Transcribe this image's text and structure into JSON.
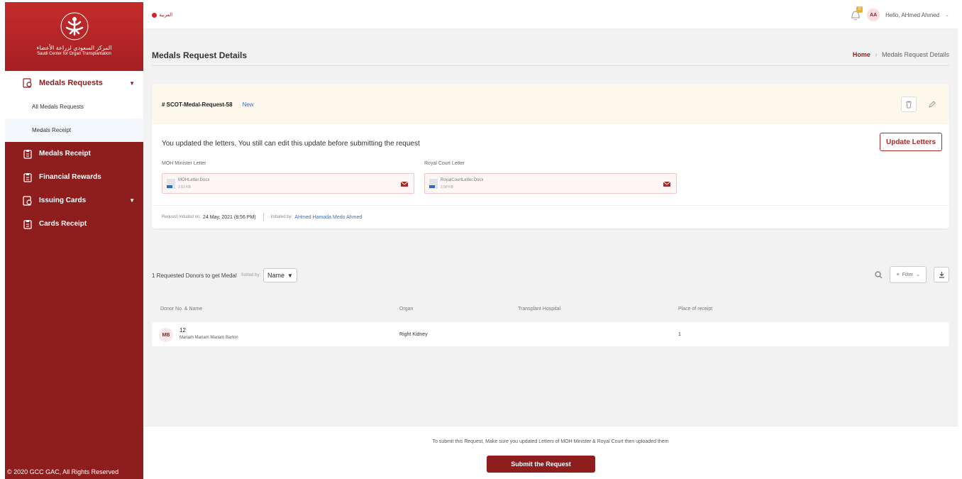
{
  "sidebar": {
    "logo_ar": "المركز السعودي لزراعة الأعضاء",
    "logo_en": "Saudi Center for Organ Transplantation",
    "group_label": "Medals Requests",
    "sub_items": [
      {
        "label": "All Medals Requests"
      },
      {
        "label": "Medals Receipt"
      }
    ],
    "items": [
      {
        "label": "Medals Receipt"
      },
      {
        "label": "Financial Rewards"
      },
      {
        "label": "Issuing Cards"
      },
      {
        "label": "Cards Receipt"
      }
    ],
    "footer": "© 2020 GCC GAC, All Rights Reserved"
  },
  "topbar": {
    "lang_label": "العربية",
    "notif_count": "0",
    "avatar": "AA",
    "greeting": "Hello, AHmed Ahmed"
  },
  "page": {
    "title": "Medals Request Details",
    "breadcrumb_home": "Home",
    "breadcrumb_sep": "›",
    "breadcrumb_current": "Medals Request Details"
  },
  "request": {
    "id": "# SCOT-Medal-Request-58",
    "status": "New",
    "update_text": "You updated the letters. You still can edit this update before submitting the request",
    "update_button": "Update Letters",
    "letters": [
      {
        "label": "MOH Minister Letter",
        "file": "MOHLetter.Docx",
        "size": "2.52 KB"
      },
      {
        "label": "Royal Court Letter",
        "file": "RoyalCourtLetter.Docx",
        "size": "2.58 KB"
      }
    ],
    "initiated_on_label": "Request Initiated on:",
    "initiated_on": "24 May, 2021 (8:56 PM)",
    "initiated_by_label": "Initiated by:",
    "initiated_by": "AHmed Hamada Medo Ahmed"
  },
  "donors": {
    "count_text": "1 Requested Donors to get Medal",
    "sorted_by_label": "Sorted by:",
    "sort_value": "Name",
    "filter_label": "Filter",
    "columns": [
      "Donor No. & Name",
      "Organ",
      "Transplant Hospital",
      "Place of receipt"
    ],
    "rows": [
      {
        "initials": "MB",
        "no": "12",
        "name": "Mariam Mariam Mariam Barton",
        "organ": "Right Kidney",
        "hospital": "",
        "place": "1"
      }
    ]
  },
  "footer": {
    "note": "To submit this Request, Make sure you updated Letters of MOH Minister & Royal Court then uploaded them",
    "submit": "Submit the Request"
  },
  "colors": {
    "brand": "#8e1d1d",
    "brand_light": "#c52c2c",
    "link": "#3b6dbf"
  }
}
